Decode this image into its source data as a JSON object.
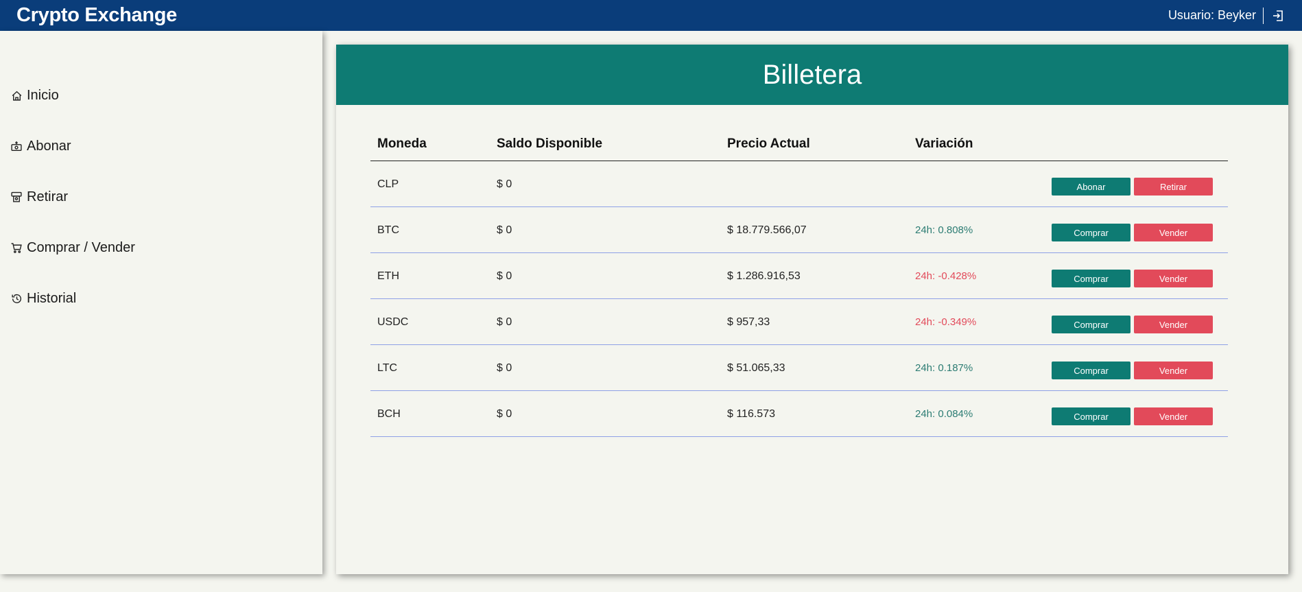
{
  "app": {
    "title": "Crypto Exchange"
  },
  "user": {
    "label": "Usuario: Beyker",
    "logout_icon": "logout-icon"
  },
  "sidebar": {
    "items": [
      {
        "label": "Inicio",
        "icon": "home-icon"
      },
      {
        "label": "Abonar",
        "icon": "deposit-icon"
      },
      {
        "label": "Retirar",
        "icon": "atm-icon"
      },
      {
        "label": "Comprar / Vender",
        "icon": "cart-icon"
      },
      {
        "label": "Historial",
        "icon": "history-icon"
      }
    ]
  },
  "wallet": {
    "title": "Billetera",
    "headers": [
      "Moneda",
      "Saldo Disponible",
      "Precio Actual",
      "Variación"
    ],
    "rows": [
      {
        "coin": "CLP",
        "balance": "$ 0",
        "price": "",
        "variation": "",
        "trend": "",
        "btn1": "Abonar",
        "btn2": "Retirar"
      },
      {
        "coin": "BTC",
        "balance": "$ 0",
        "price": "$ 18.779.566,07",
        "variation": "24h: 0.808%",
        "trend": "up",
        "btn1": "Comprar",
        "btn2": "Vender"
      },
      {
        "coin": "ETH",
        "balance": "$ 0",
        "price": "$ 1.286.916,53",
        "variation": "24h: -0.428%",
        "trend": "down",
        "btn1": "Comprar",
        "btn2": "Vender"
      },
      {
        "coin": "USDC",
        "balance": "$ 0",
        "price": "$ 957,33",
        "variation": "24h: -0.349%",
        "trend": "down",
        "btn1": "Comprar",
        "btn2": "Vender"
      },
      {
        "coin": "LTC",
        "balance": "$ 0",
        "price": "$ 51.065,33",
        "variation": "24h: 0.187%",
        "trend": "up",
        "btn1": "Comprar",
        "btn2": "Vender"
      },
      {
        "coin": "BCH",
        "balance": "$ 0",
        "price": "$ 116.573",
        "variation": "24h: 0.084%",
        "trend": "up",
        "btn1": "Comprar",
        "btn2": "Vender"
      }
    ]
  },
  "colors": {
    "topbar": "#0a3d7a",
    "header": "#0e7b73",
    "positive": "#2c7c73",
    "negative": "#e24a5a",
    "divider": "#8ea0e6"
  }
}
